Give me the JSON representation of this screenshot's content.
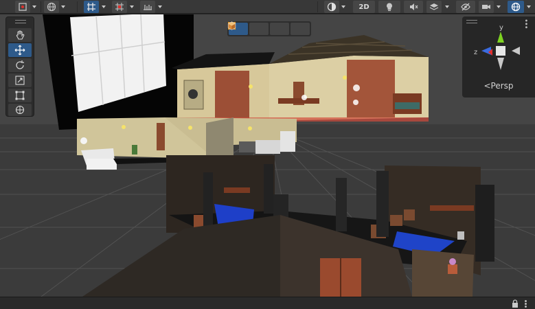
{
  "toolbar": {
    "mode_2d_label": "2D"
  },
  "gizmo": {
    "axis_y": "y",
    "axis_z": "z",
    "projection_label": "Persp"
  },
  "colors": {
    "accent": "#2e5a8a",
    "toolbar_bg": "#383838",
    "panel_bg": "#2b2b2b",
    "axis_y": "#7ed321",
    "axis_z": "#3a6be0",
    "axis_x": "#e0302c"
  },
  "icons": {
    "tools": [
      "hand-icon",
      "move-icon",
      "rotate-icon",
      "scale-icon",
      "rect-transform-icon",
      "transform-icon"
    ],
    "draw_modes": [
      "wireframe-cube-icon",
      "bounds-icon",
      "shaded-wireframe-cube-icon",
      "shaded-cube-icon"
    ]
  }
}
